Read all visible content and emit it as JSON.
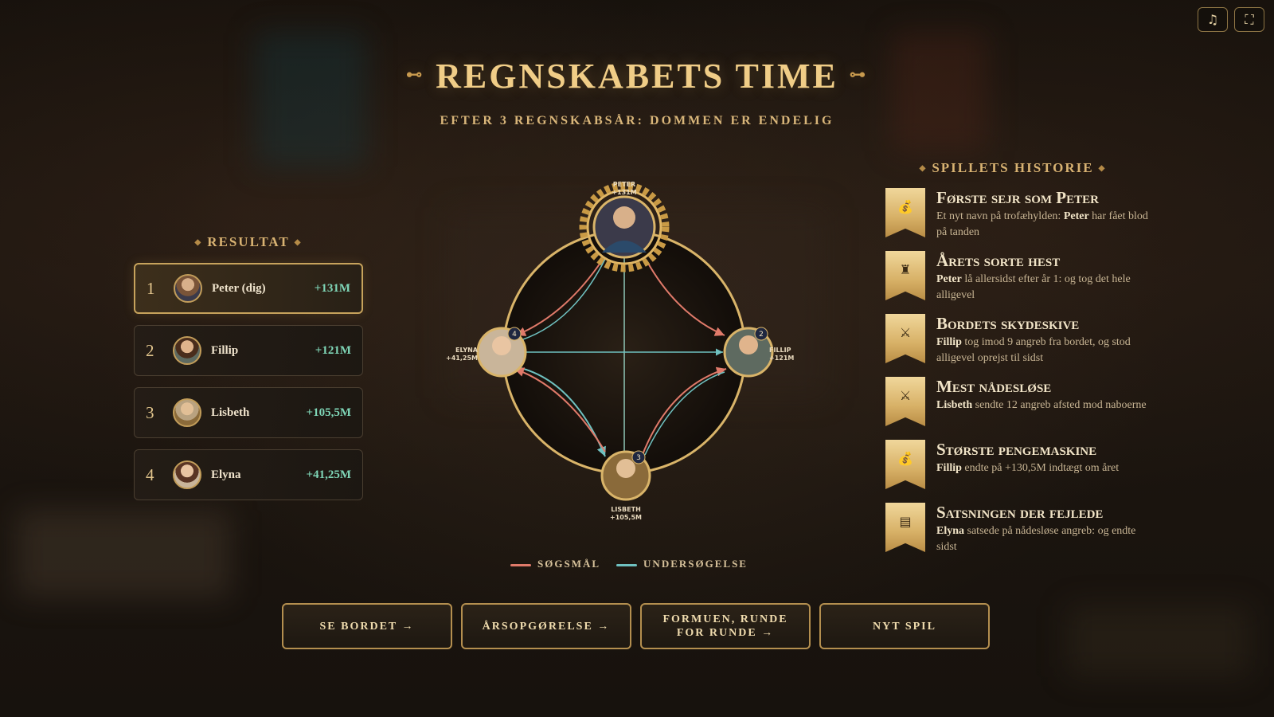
{
  "title": "REGNSKABETS TIME",
  "subtitle": "EFTER 3 REGNSKABSÅR: DOMMEN ER ENDELIG",
  "title_ornament_left": "⊷",
  "title_ornament_right": "⊶",
  "topbar": {
    "music_icon": "♫",
    "fullscreen_icon": "⛶"
  },
  "results": {
    "heading": "RESULTAT",
    "rows": [
      {
        "rank": "1",
        "name": "Peter (dig)",
        "value": "+131M"
      },
      {
        "rank": "2",
        "name": "Fillip",
        "value": "+121M"
      },
      {
        "rank": "3",
        "name": "Lisbeth",
        "value": "+105,5M"
      },
      {
        "rank": "4",
        "name": "Elyna",
        "value": "+41,25M"
      }
    ]
  },
  "diagram": {
    "nodes": {
      "peter": {
        "name": "PETER",
        "value": "+131M",
        "badge": ""
      },
      "fillip": {
        "name": "FILLIP",
        "value": "+121M",
        "badge": "2"
      },
      "lisbeth": {
        "name": "LISBETH",
        "value": "+105,5M",
        "badge": "3"
      },
      "elyna": {
        "name": "ELYNA",
        "value": "+41,25M",
        "badge": "4"
      }
    },
    "colors": {
      "lawsuit": "#e07a6a",
      "investigation": "#6fc1c0",
      "gold": "#d9b469"
    }
  },
  "legend": {
    "lawsuit": "SØGSMÅL",
    "investigation": "UNDERSØGELSE"
  },
  "history": {
    "heading": "SPILLETS HISTORIE",
    "items": [
      {
        "icon": "money-bag-icon",
        "glyph": "💰",
        "title": "Første sejr som Peter",
        "desc_pre": "Et nyt navn på trofæhylden: ",
        "desc_bold": "Peter",
        "desc_post": " har fået blod på tanden",
        "bold_first": false
      },
      {
        "icon": "throne-icon",
        "glyph": "♜",
        "title": "Årets sorte hest",
        "desc_pre": "",
        "desc_bold": "Peter",
        "desc_post": " lå allersidst efter år 1: og tog det hele alligevel",
        "bold_first": true
      },
      {
        "icon": "crossed-swords-icon",
        "glyph": "⚔",
        "title": "Bordets skydeskive",
        "desc_pre": "",
        "desc_bold": "Fillip",
        "desc_post": " tog imod 9 angreb fra bordet, og stod alligevel oprejst til sidst",
        "bold_first": true
      },
      {
        "icon": "crossed-swords-icon",
        "glyph": "⚔",
        "title": "Mest nådesløse",
        "desc_pre": "",
        "desc_bold": "Lisbeth",
        "desc_post": " sendte 12 angreb afsted mod naboerne",
        "bold_first": true
      },
      {
        "icon": "money-bag-icon",
        "glyph": "💰",
        "title": "Største pengemaskine",
        "desc_pre": "",
        "desc_bold": "Fillip",
        "desc_post": " endte på +130,5M indtægt om året",
        "bold_first": true
      },
      {
        "icon": "ledger-icon",
        "glyph": "▤",
        "title": "Satsningen der fejlede",
        "desc_pre": "",
        "desc_bold": "Elyna",
        "desc_post": " satsede på nådesløse angreb: og endte sidst",
        "bold_first": true
      }
    ]
  },
  "actions": {
    "see_table": "SE BORDET →",
    "annual_report": "ÅRSOPGØRELSE →",
    "fortune": "FORMUEN, RUNDE FOR RUNDE →",
    "new_game": "NYT SPIL"
  }
}
